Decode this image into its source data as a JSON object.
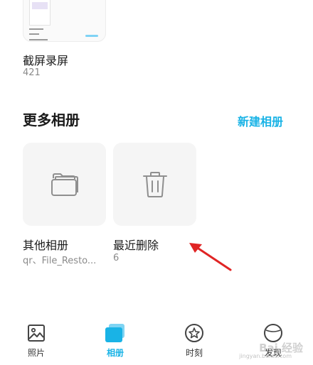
{
  "albums_top": {
    "name": "截屏录屏",
    "count": "421"
  },
  "more_albums": {
    "title": "更多相册",
    "new_album_label": "新建相册",
    "items": [
      {
        "name": "其他相册",
        "detail": "qr、File_Resto..."
      },
      {
        "name": "最近删除",
        "detail": "6"
      }
    ]
  },
  "bottom_nav": {
    "items": [
      {
        "label": "照片",
        "icon": "image-icon"
      },
      {
        "label": "相册",
        "icon": "albums-icon",
        "active": true
      },
      {
        "label": "时刻",
        "icon": "star-icon"
      },
      {
        "label": "发现",
        "icon": "discover-icon"
      }
    ]
  },
  "watermark": {
    "text": "Bai 经验",
    "sub": "jingyan.baidu.com"
  },
  "colors": {
    "accent": "#19b3e6",
    "card_bg": "#f5f5f5",
    "annotation": "#e02424"
  }
}
